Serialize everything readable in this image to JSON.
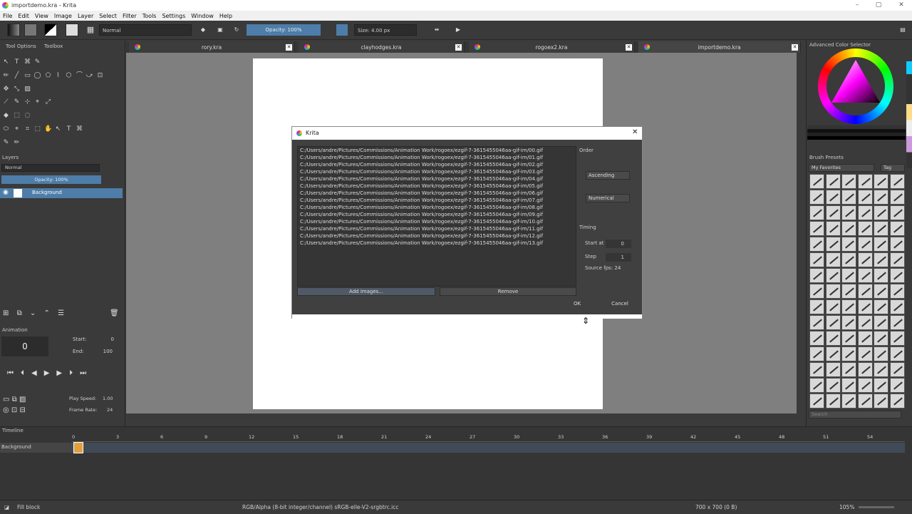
{
  "window": {
    "title": "importdemo.kra - Krita"
  },
  "menu": [
    "File",
    "Edit",
    "View",
    "Image",
    "Layer",
    "Select",
    "Filter",
    "Tools",
    "Settings",
    "Window",
    "Help"
  ],
  "toolbar": {
    "blend_mode": "Normal",
    "opacity": "Opacity: 100%",
    "size": "Size: 4.00 px"
  },
  "left_tabs": {
    "tool_options": "Tool Options",
    "toolbox": "Toolbox"
  },
  "layers": {
    "title": "Layers",
    "mode": "Normal",
    "opacity": "Opacity: 100%",
    "layer_name": "Background"
  },
  "animation": {
    "title": "Animation",
    "frame": "0",
    "start_label": "Start:",
    "start": "0",
    "end_label": "End:",
    "end": "100",
    "play_speed_label": "Play Speed:",
    "play_speed": "1.00",
    "frame_rate_label": "Frame Rate:",
    "frame_rate": "24"
  },
  "doc_tabs": [
    "rory.kra",
    "clayhodges.kra",
    "rogoex2.kra",
    "importdemo.kra"
  ],
  "dialog": {
    "title": "Krita",
    "files": [
      "C:/Users/andre/Pictures/Commissions/Animation Work/rogoex/ezgif-7-3615455046aa-gif-im/00.gif",
      "C:/Users/andre/Pictures/Commissions/Animation Work/rogoex/ezgif-7-3615455046aa-gif-im/01.gif",
      "C:/Users/andre/Pictures/Commissions/Animation Work/rogoex/ezgif-7-3615455046aa-gif-im/02.gif",
      "C:/Users/andre/Pictures/Commissions/Animation Work/rogoex/ezgif-7-3615455046aa-gif-im/03.gif",
      "C:/Users/andre/Pictures/Commissions/Animation Work/rogoex/ezgif-7-3615455046aa-gif-im/04.gif",
      "C:/Users/andre/Pictures/Commissions/Animation Work/rogoex/ezgif-7-3615455046aa-gif-im/05.gif",
      "C:/Users/andre/Pictures/Commissions/Animation Work/rogoex/ezgif-7-3615455046aa-gif-im/06.gif",
      "C:/Users/andre/Pictures/Commissions/Animation Work/rogoex/ezgif-7-3615455046aa-gif-im/07.gif",
      "C:/Users/andre/Pictures/Commissions/Animation Work/rogoex/ezgif-7-3615455046aa-gif-im/08.gif",
      "C:/Users/andre/Pictures/Commissions/Animation Work/rogoex/ezgif-7-3615455046aa-gif-im/09.gif",
      "C:/Users/andre/Pictures/Commissions/Animation Work/rogoex/ezgif-7-3615455046aa-gif-im/10.gif",
      "C:/Users/andre/Pictures/Commissions/Animation Work/rogoex/ezgif-7-3615455046aa-gif-im/11.gif",
      "C:/Users/andre/Pictures/Commissions/Animation Work/rogoex/ezgif-7-3615455046aa-gif-im/12.gif",
      "C:/Users/andre/Pictures/Commissions/Animation Work/rogoex/ezgif-7-3615455046aa-gif-im/13.gif"
    ],
    "order_label": "Order",
    "order_dir": "Ascending",
    "order_type": "Numerical",
    "timing_label": "Timing",
    "start_at_label": "Start at",
    "start_at": "0",
    "step_label": "Step",
    "step": "1",
    "source_fps": "Source fps: 24",
    "add_images": "Add images...",
    "remove": "Remove",
    "ok": "OK",
    "cancel": "Cancel"
  },
  "right": {
    "color_selector": "Advanced Color Selector",
    "brush_presets": "Brush Presets",
    "favorites": "My Favorites",
    "tag": "Tag",
    "search": "Search"
  },
  "timeline": {
    "title": "Timeline",
    "layer": "Background",
    "frames": [
      "0",
      "3",
      "6",
      "9",
      "12",
      "15",
      "18",
      "21",
      "24",
      "27",
      "30",
      "33",
      "36",
      "39",
      "42",
      "45",
      "48",
      "51",
      "54"
    ]
  },
  "status": {
    "tool": "Fill block",
    "color": "RGB/Alpha (8-bit integer/channel)  sRGB-elle-V2-srgbtrc.icc",
    "dims": "700 x 700 (0 B)",
    "zoom": "105%"
  }
}
